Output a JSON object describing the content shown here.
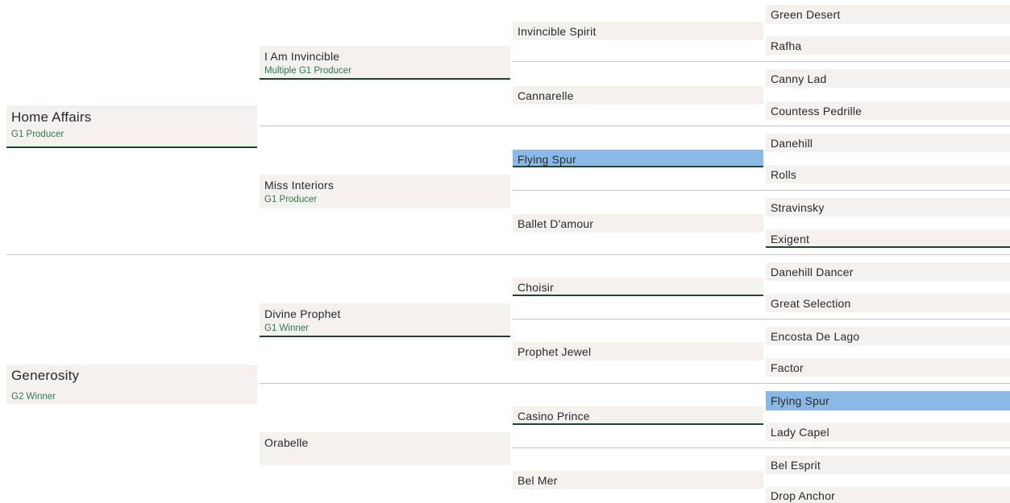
{
  "gen1": [
    {
      "name": "Home Affairs",
      "status": "G1 Producer"
    },
    {
      "name": "Generosity",
      "status": "G2 Winner"
    }
  ],
  "gen2": [
    {
      "name": "I Am Invincible",
      "status": "Multiple G1 Producer"
    },
    {
      "name": "Miss Interiors",
      "status": "G1 Producer"
    },
    {
      "name": "Divine Prophet",
      "status": "G1 Winner"
    },
    {
      "name": "Orabelle",
      "status": ""
    }
  ],
  "gen3": [
    {
      "name": "Invincible Spirit"
    },
    {
      "name": "Cannarelle"
    },
    {
      "name": "Flying Spur"
    },
    {
      "name": "Ballet D'amour"
    },
    {
      "name": "Choisir"
    },
    {
      "name": "Prophet Jewel"
    },
    {
      "name": "Casino Prince"
    },
    {
      "name": "Bel Mer"
    }
  ],
  "gen4": [
    {
      "name": "Green Desert"
    },
    {
      "name": "Rafha"
    },
    {
      "name": "Canny Lad"
    },
    {
      "name": "Countess Pedrille"
    },
    {
      "name": "Danehill"
    },
    {
      "name": "Rolls"
    },
    {
      "name": "Stravinsky"
    },
    {
      "name": "Exigent"
    },
    {
      "name": "Danehill Dancer"
    },
    {
      "name": "Great Selection"
    },
    {
      "name": "Encosta De Lago"
    },
    {
      "name": "Factor"
    },
    {
      "name": "Flying Spur"
    },
    {
      "name": "Lady Capel"
    },
    {
      "name": "Bel Esprit"
    },
    {
      "name": "Drop Anchor"
    }
  ],
  "colors": {
    "cell_background": "#f4f1ee",
    "highlight": "#8ab9e8",
    "underline": "#1c4530",
    "status_text": "#2e7a4a",
    "separator": "#c9c9c9"
  }
}
